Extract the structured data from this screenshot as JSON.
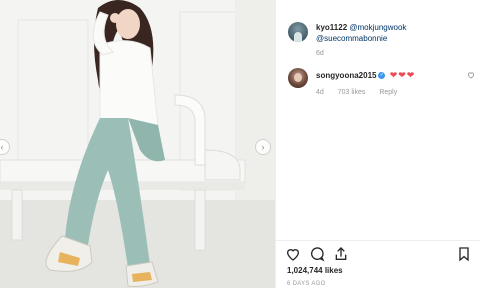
{
  "caption": {
    "username": "kyo1122",
    "mention_1": "@mokjungwook",
    "mention_2": "@suecommabonnie",
    "age": "6d"
  },
  "comment": {
    "username": "songyoona2015",
    "hearts": "❤❤❤",
    "age": "4d",
    "likes": "703 likes",
    "reply": "Reply"
  },
  "post": {
    "likes_count": "1,024,744 likes",
    "timestamp": "6 DAYS AGO"
  },
  "carousel": {
    "prev_glyph": "‹",
    "next_glyph": "›"
  },
  "icons": {
    "heart": "heart-icon",
    "comment": "comment-icon",
    "share": "share-icon",
    "bookmark": "bookmark-icon",
    "comment_like": "heart-outline-icon",
    "verified": "verified-badge-icon"
  },
  "colors": {
    "verified": "#3897f0",
    "hearts": "#ed4956",
    "mention": "#003569",
    "secondary_text": "#999999"
  }
}
